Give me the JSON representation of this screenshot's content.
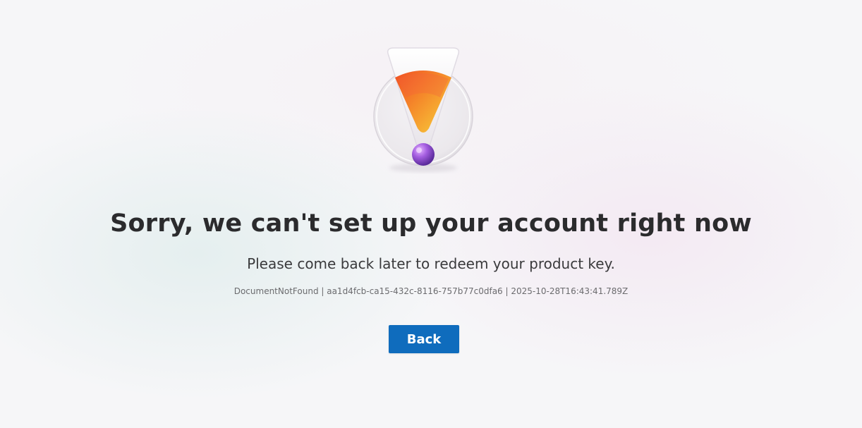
{
  "error": {
    "title": "Sorry, we can't set up your account right now",
    "message": "Please come back later to redeem your product key.",
    "diagnostics": "DocumentNotFound | aa1d4fcb-ca15-432c-8116-757b77c0dfa6 | 2025-10-28T16:43:41.789Z",
    "icon": "warning-exclamation-icon"
  },
  "actions": {
    "back_label": "Back"
  },
  "colors": {
    "button": "#0f6cbd",
    "title": "#2b2b2d",
    "warning_gradient_start": "#f6d23b",
    "warning_gradient_end": "#f0562a",
    "dot": "#9b4fd6"
  }
}
